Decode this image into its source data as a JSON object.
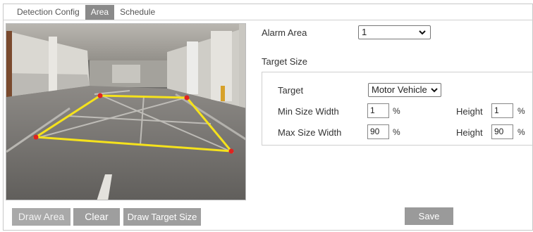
{
  "tabs": [
    {
      "label": "Detection Config",
      "active": false
    },
    {
      "label": "Area",
      "active": true
    },
    {
      "label": "Schedule",
      "active": false
    }
  ],
  "buttons": {
    "draw_area": "Draw Area",
    "clear": "Clear",
    "draw_target_size": "Draw Target Size",
    "save": "Save"
  },
  "alarm_area": {
    "label": "Alarm Area",
    "value": "1"
  },
  "target_size": {
    "section_label": "Target Size",
    "target_label": "Target",
    "target_value": "Motor Vehicle",
    "min_width_label": "Min Size Width",
    "min_width_value": "1",
    "min_height_label": "Height",
    "min_height_value": "1",
    "max_width_label": "Max Size Width",
    "max_width_value": "90",
    "max_height_label": "Height",
    "max_height_value": "90",
    "unit": "%"
  },
  "colors": {
    "area_outline": "#f5e21c",
    "area_vertex": "#e0231f",
    "active_tab": "#8a8a8a",
    "button": "#9e9e9e"
  },
  "icons": {
    "dropdown": "chevron-down-icon"
  }
}
